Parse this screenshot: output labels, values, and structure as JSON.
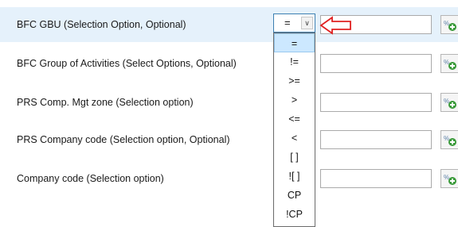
{
  "rows": [
    {
      "label": "BFC GBU (Selection Option, Optional)"
    },
    {
      "label": "BFC Group of Activities (Select Options, Optional)"
    },
    {
      "label": "PRS Comp. Mgt zone (Selection option)"
    },
    {
      "label": "PRS Company code (Selection option, Optional)"
    },
    {
      "label": "Company code (Selection option)"
    }
  ],
  "operator_select": {
    "value": "="
  },
  "operator_options": [
    "=",
    "!=",
    ">=",
    ">",
    "<=",
    "<",
    "[ ]",
    "![ ]",
    "CP",
    "!CP"
  ],
  "icons": {
    "add_value": "add-value-icon",
    "pointer_arrow": "red-arrow-icon",
    "dropdown": "chevron-down-icon"
  },
  "colors": {
    "row_highlight": "#e5f1fb",
    "pointer_arrow": "#e02020",
    "selected_option": "#cce8ff"
  }
}
